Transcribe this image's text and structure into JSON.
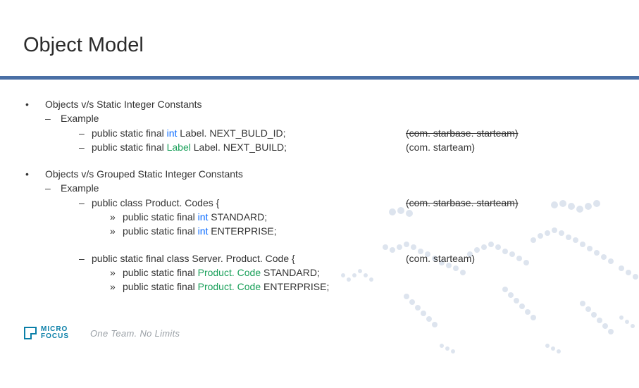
{
  "title": "Object Model",
  "bullets": [
    {
      "text": "Objects v/s Static Integer Constants",
      "children": [
        {
          "text": "Example",
          "children": [
            {
              "code": {
                "prefix": "public static final ",
                "kw": "int",
                "suffix": " Label. NEXT_BULD_ID;"
              },
              "aside": {
                "text": "(com. starbase. starteam)",
                "strike": true
              }
            },
            {
              "code": {
                "prefix": "public static final ",
                "tp": "Label",
                "suffix": " Label. NEXT_BUILD;"
              },
              "aside": {
                "text": "(com. starteam)",
                "strike": false
              }
            }
          ]
        }
      ]
    },
    {
      "text": "Objects v/s Grouped Static Integer Constants",
      "children": [
        {
          "text": "Example",
          "children": [
            {
              "code": {
                "prefix": "public class Product. Codes {",
                "kw": "",
                "suffix": ""
              },
              "aside": {
                "text": "(com. starbase. starteam)",
                "strike": true
              },
              "sub": [
                {
                  "code": {
                    "prefix": "public static final ",
                    "kw": "int",
                    "suffix": " STANDARD;"
                  }
                },
                {
                  "code": {
                    "prefix": "public static final ",
                    "kw": "int",
                    "suffix": " ENTERPRISE;"
                  }
                }
              ]
            },
            {
              "gapBefore": true,
              "code": {
                "prefix": "public static final class Server. Product. Code {",
                "kw": "",
                "suffix": ""
              },
              "aside": {
                "text": "(com. starteam)",
                "strike": false
              },
              "sub": [
                {
                  "code": {
                    "prefix": "public static final ",
                    "tp": "Product. Code",
                    "suffix": " STANDARD;"
                  }
                },
                {
                  "code": {
                    "prefix": "public static final ",
                    "tp": "Product. Code",
                    "suffix": " ENTERPRISE;"
                  }
                }
              ]
            }
          ]
        }
      ]
    }
  ],
  "logo": {
    "line1": "MICRO",
    "line2": "FOCUS"
  },
  "tagline": "One Team. No Limits"
}
